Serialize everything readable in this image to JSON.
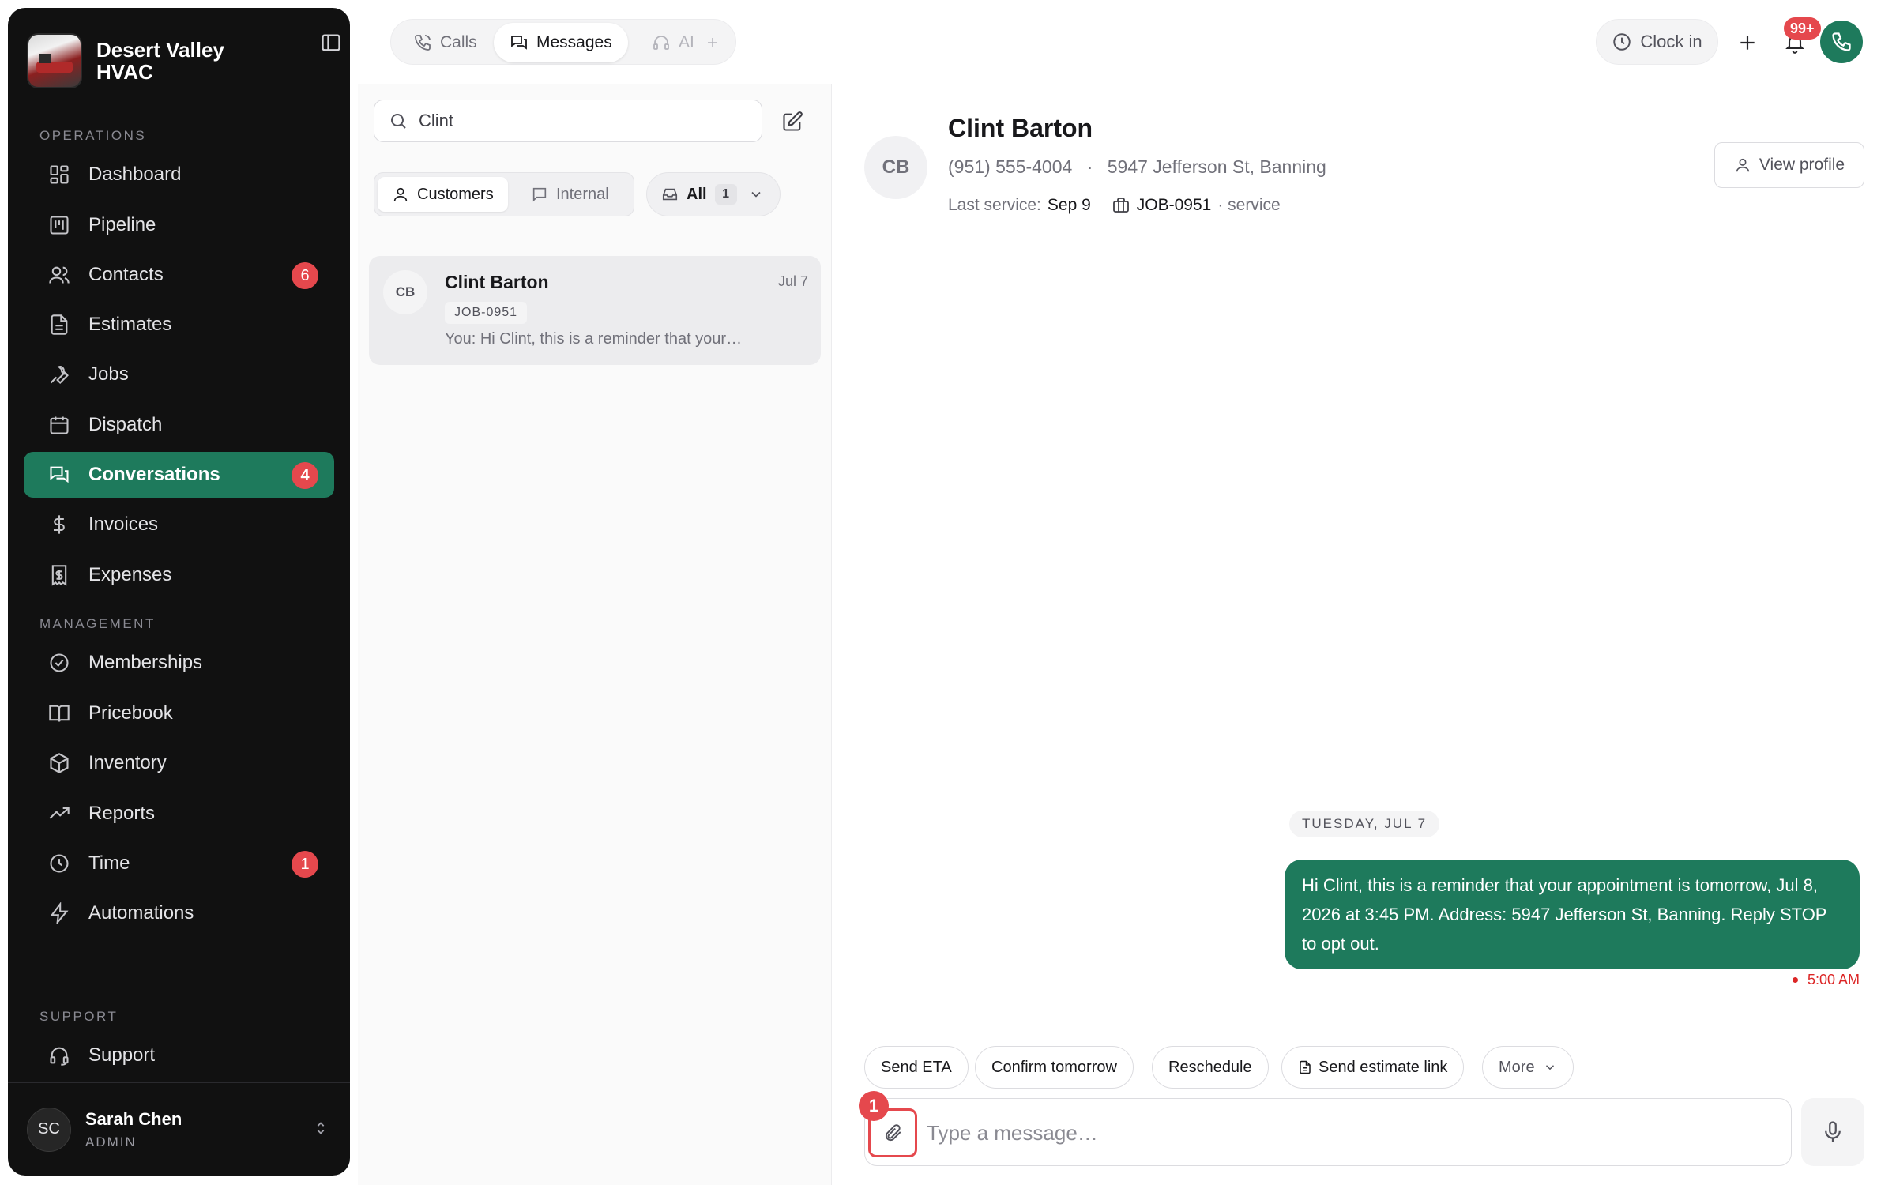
{
  "brand": {
    "name": "Desert Valley HVAC"
  },
  "sidebar": {
    "sections": {
      "operations": "OPERATIONS",
      "management": "MANAGEMENT",
      "support": "SUPPORT"
    },
    "items": [
      {
        "label": "Dashboard",
        "icon": "dashboard-icon"
      },
      {
        "label": "Pipeline",
        "icon": "pipeline-icon"
      },
      {
        "label": "Contacts",
        "icon": "contacts-icon",
        "badge": "6"
      },
      {
        "label": "Estimates",
        "icon": "estimates-icon"
      },
      {
        "label": "Jobs",
        "icon": "wrench-icon"
      },
      {
        "label": "Dispatch",
        "icon": "calendar-icon"
      },
      {
        "label": "Conversations",
        "icon": "chat-icon",
        "badge": "4",
        "active": true
      },
      {
        "label": "Invoices",
        "icon": "dollar-icon"
      },
      {
        "label": "Expenses",
        "icon": "receipt-icon"
      },
      {
        "label": "Memberships",
        "icon": "badge-check-icon"
      },
      {
        "label": "Pricebook",
        "icon": "book-icon"
      },
      {
        "label": "Inventory",
        "icon": "box-icon"
      },
      {
        "label": "Reports",
        "icon": "trend-icon"
      },
      {
        "label": "Time",
        "icon": "clock-icon",
        "badge": "1"
      },
      {
        "label": "Automations",
        "icon": "bolt-icon"
      },
      {
        "label": "Support",
        "icon": "headset-icon"
      }
    ],
    "user": {
      "initials": "SC",
      "name": "Sarah Chen",
      "role": "ADMIN"
    }
  },
  "topbar": {
    "tabs": [
      {
        "label": "Calls",
        "icon": "phone-call-icon"
      },
      {
        "label": "Messages",
        "icon": "messages-icon",
        "active": true
      },
      {
        "label": "AI",
        "icon": "headphones-icon"
      }
    ],
    "clock_in": "Clock in",
    "notifications_badge": "99+"
  },
  "list": {
    "search_value": "Clint",
    "filters": {
      "customers": "Customers",
      "internal": "Internal",
      "all": "All",
      "all_count": "1"
    },
    "conversations": [
      {
        "initials": "CB",
        "name": "Clint Barton",
        "date": "Jul 7",
        "tag": "JOB-0951",
        "preview": "You: Hi Clint, this is a reminder that your…"
      }
    ]
  },
  "detail": {
    "initials": "CB",
    "name": "Clint Barton",
    "phone": "(951) 555-4004",
    "separator": "·",
    "address": "5947 Jefferson St, Banning",
    "last_service_label": "Last service:",
    "last_service_value": "Sep 9",
    "job_id": "JOB-0951",
    "job_type": "· service",
    "view_profile": "View profile",
    "date_divider": "TUESDAY, JUL 7",
    "messages": [
      {
        "text": "Hi Clint, this is a reminder that your appointment is tomorrow, Jul 8, 2026 at 3:45 PM. Address: 5947 Jefferson St, Banning. Reply STOP to opt out.",
        "time": "5:00 AM"
      }
    ],
    "quick_replies": [
      "Send ETA",
      "Confirm tomorrow",
      "Reschedule",
      "Send estimate link",
      "More"
    ],
    "composer": {
      "placeholder": "Type a message…",
      "attach_badge": "1"
    }
  },
  "colors": {
    "accent": "#1e7a5c",
    "badge": "#e5484d",
    "sidebar_bg": "#111111"
  }
}
